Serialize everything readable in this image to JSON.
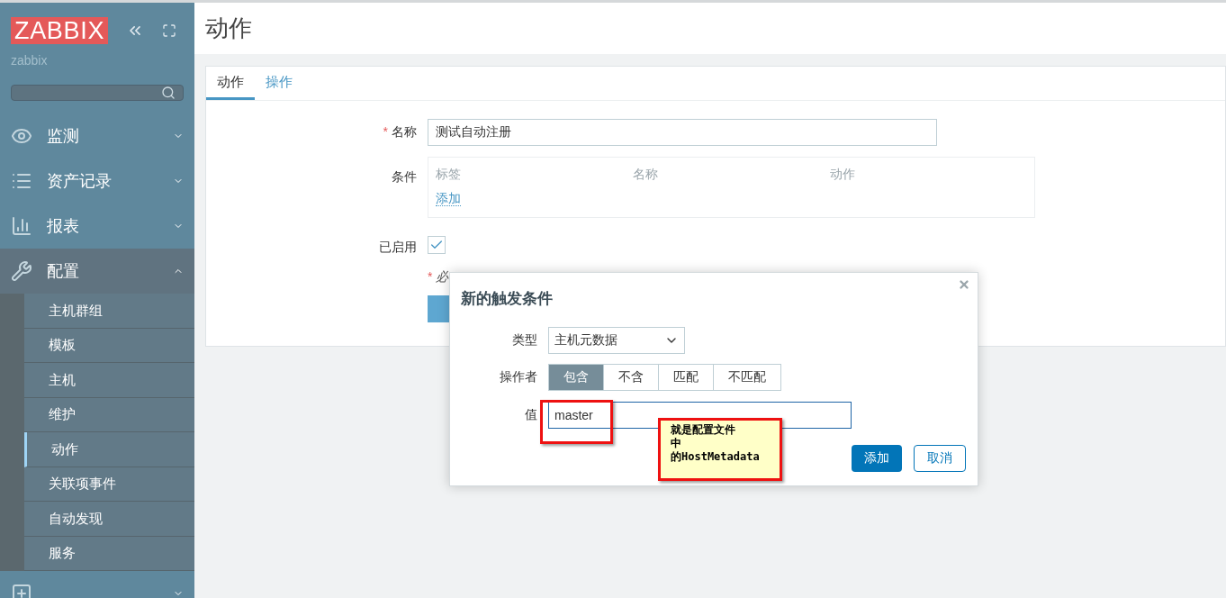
{
  "sidebar": {
    "logo": "ZABBIX",
    "user": "zabbix",
    "menu": [
      {
        "label": "监测",
        "expanded": false
      },
      {
        "label": "资产记录",
        "expanded": false
      },
      {
        "label": "报表",
        "expanded": false
      },
      {
        "label": "配置",
        "expanded": true,
        "children": [
          {
            "label": "主机群组",
            "selected": false
          },
          {
            "label": "模板",
            "selected": false
          },
          {
            "label": "主机",
            "selected": false
          },
          {
            "label": "维护",
            "selected": false
          },
          {
            "label": "动作",
            "selected": true
          },
          {
            "label": "关联项事件",
            "selected": false
          },
          {
            "label": "自动发现",
            "selected": false
          },
          {
            "label": "服务",
            "selected": false
          }
        ]
      },
      {
        "expanded": false
      }
    ]
  },
  "page": {
    "title": "动作",
    "tabs": [
      {
        "label": "动作",
        "selected": true
      },
      {
        "label": "操作",
        "selected": false
      }
    ],
    "form": {
      "required_mark": "*",
      "name_label": "名称",
      "name_value": "测试自动注册",
      "conditions_label": "条件",
      "conditions_columns": [
        "标签",
        "名称",
        "动作"
      ],
      "conditions_add": "添加",
      "enabled_label": "已启用",
      "enabled_checked": true,
      "note_mark": "*",
      "required_note": "必"
    }
  },
  "dialog": {
    "title": "新的触发条件",
    "type_label": "类型",
    "type_value": "主机元数据",
    "operator_label": "操作者",
    "operators": [
      {
        "label": "包含",
        "selected": true
      },
      {
        "label": "不含",
        "selected": false
      },
      {
        "label": "匹配",
        "selected": false
      },
      {
        "label": "不匹配",
        "selected": false
      }
    ],
    "value_label": "值",
    "value": "master",
    "buttons": [
      {
        "label": "添加",
        "kind": "primary"
      },
      {
        "label": "取消",
        "kind": "secondary"
      }
    ]
  },
  "annotation": {
    "lines": [
      "就是配置文件",
      "中",
      "的HostMetadata"
    ]
  }
}
